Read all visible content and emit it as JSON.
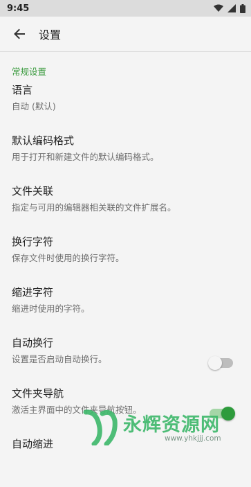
{
  "status_bar": {
    "time": "9:45"
  },
  "app_bar": {
    "title": "设置"
  },
  "section": {
    "title": "常规设置"
  },
  "preferences": [
    {
      "title": "语言",
      "summary": "自动 (默认)"
    },
    {
      "title": "默认编码格式",
      "summary": "用于打开和新建文件的默认编码格式。"
    },
    {
      "title": "文件关联",
      "summary": "指定与可用的编辑器相关联的文件扩展名。"
    },
    {
      "title": "换行字符",
      "summary": "保存文件时使用的换行字符。"
    },
    {
      "title": "缩进字符",
      "summary": "缩进时使用的字符。"
    },
    {
      "title": "自动换行",
      "summary": "设置是否启动自动换行。",
      "toggle": false
    },
    {
      "title": "文件夹导航",
      "summary": "激活主界面中的文件夹导航按钮。",
      "toggle": true
    },
    {
      "title": "自动缩进",
      "summary": ""
    }
  ],
  "watermark": {
    "text": "永辉资源网",
    "url": "www.yhkjjj.com"
  },
  "colors": {
    "accent": "#3a9a3e",
    "background": "#f4f4f4"
  }
}
